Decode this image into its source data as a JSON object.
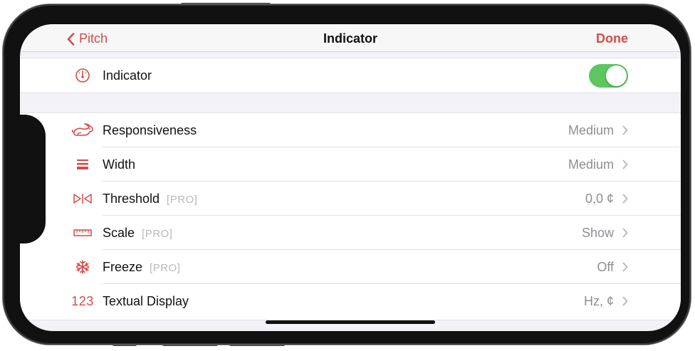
{
  "nav": {
    "back_label": "Pitch",
    "title": "Indicator",
    "done_label": "Done"
  },
  "indicator_row": {
    "label": "Indicator",
    "icon": "gauge-icon",
    "toggle_on": true
  },
  "settings": [
    {
      "id": "responsiveness",
      "icon": "rabbit-icon",
      "label": "Responsiveness",
      "pro": "",
      "value": "Medium"
    },
    {
      "id": "width",
      "icon": "lines-icon",
      "label": "Width",
      "pro": "",
      "value": "Medium"
    },
    {
      "id": "threshold",
      "icon": "threshold-icon",
      "label": "Threshold",
      "pro": "[PRO]",
      "value": "0,0 ¢"
    },
    {
      "id": "scale",
      "icon": "ruler-icon",
      "label": "Scale",
      "pro": "[PRO]",
      "value": "Show"
    },
    {
      "id": "freeze",
      "icon": "snowflake-icon",
      "label": "Freeze",
      "pro": "[PRO]",
      "value": "Off"
    },
    {
      "id": "textual-display",
      "icon": "number-icon",
      "icon_text": "123",
      "label": "Textual Display",
      "pro": "",
      "value": "Hz, ¢"
    }
  ],
  "colors": {
    "accent": "#d14d4a",
    "toggle_on": "#5cc660",
    "value_gray": "#8e8e93",
    "pro_gray": "#b9b9be"
  }
}
